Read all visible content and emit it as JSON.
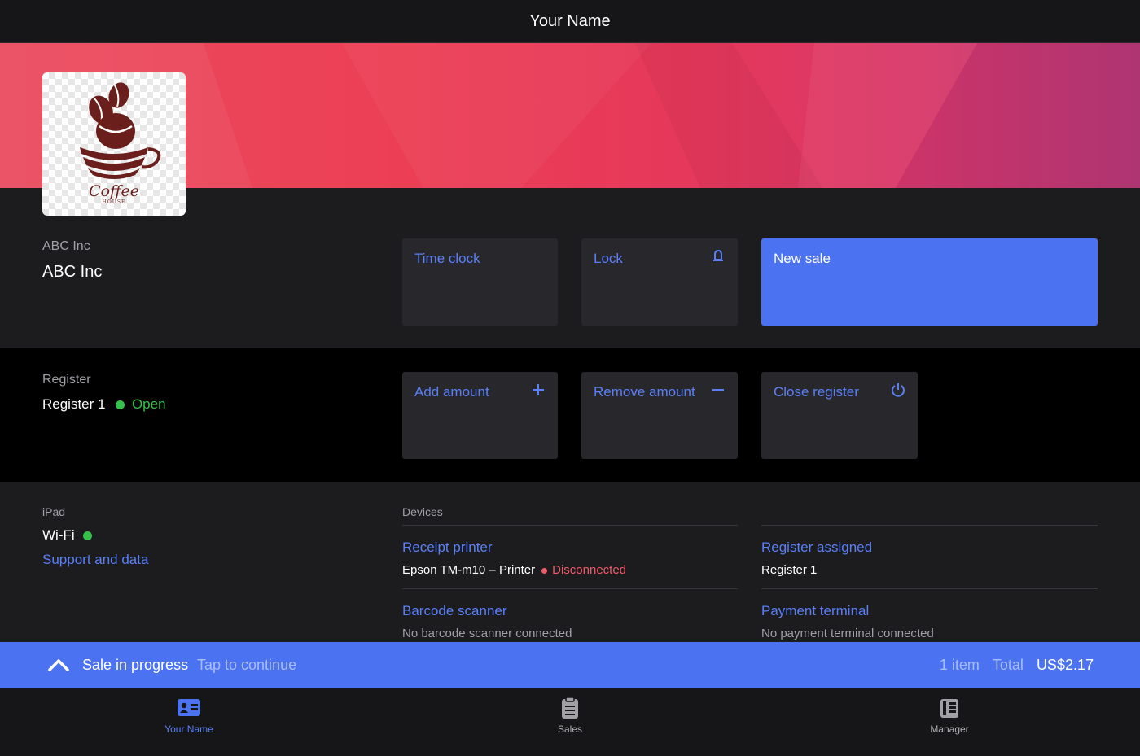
{
  "header": {
    "title": "Your Name"
  },
  "logo": {
    "text_main": "Coffee",
    "text_sub": "HOUSE"
  },
  "company": {
    "label": "ABC Inc",
    "name": "ABC Inc"
  },
  "actions": {
    "time_clock": "Time clock",
    "lock": "Lock",
    "new_sale": "New sale"
  },
  "register": {
    "label": "Register",
    "name": "Register 1",
    "status": "Open",
    "add_amount": "Add amount",
    "remove_amount": "Remove amount",
    "close_register": "Close register"
  },
  "device_info": {
    "label": "iPad",
    "wifi": "Wi-Fi",
    "support_link": "Support and data"
  },
  "devices": {
    "heading": "Devices",
    "receipt_printer": {
      "title": "Receipt printer",
      "device": "Epson TM-m10 – Printer",
      "status": "Disconnected"
    },
    "register_assigned": {
      "title": "Register assigned",
      "value": "Register 1"
    },
    "barcode_scanner": {
      "title": "Barcode scanner",
      "value": "No barcode scanner connected"
    },
    "payment_terminal": {
      "title": "Payment terminal",
      "value": "No payment terminal connected"
    }
  },
  "sale_bar": {
    "title": "Sale in progress",
    "hint": "Tap to continue",
    "items": "1 item",
    "total_label": "Total",
    "total_value": "US$2.17"
  },
  "tabs": [
    {
      "label": "Your Name",
      "icon": "id-card-icon",
      "active": true
    },
    {
      "label": "Sales",
      "icon": "clipboard-icon",
      "active": false
    },
    {
      "label": "Manager",
      "icon": "ledger-icon",
      "active": false
    }
  ],
  "colors": {
    "accent": "#4a72f1",
    "link": "#5a7ff6",
    "open_green": "#35c24a",
    "disconnected_red": "#f05a6a",
    "banner": "#ec3f55"
  }
}
